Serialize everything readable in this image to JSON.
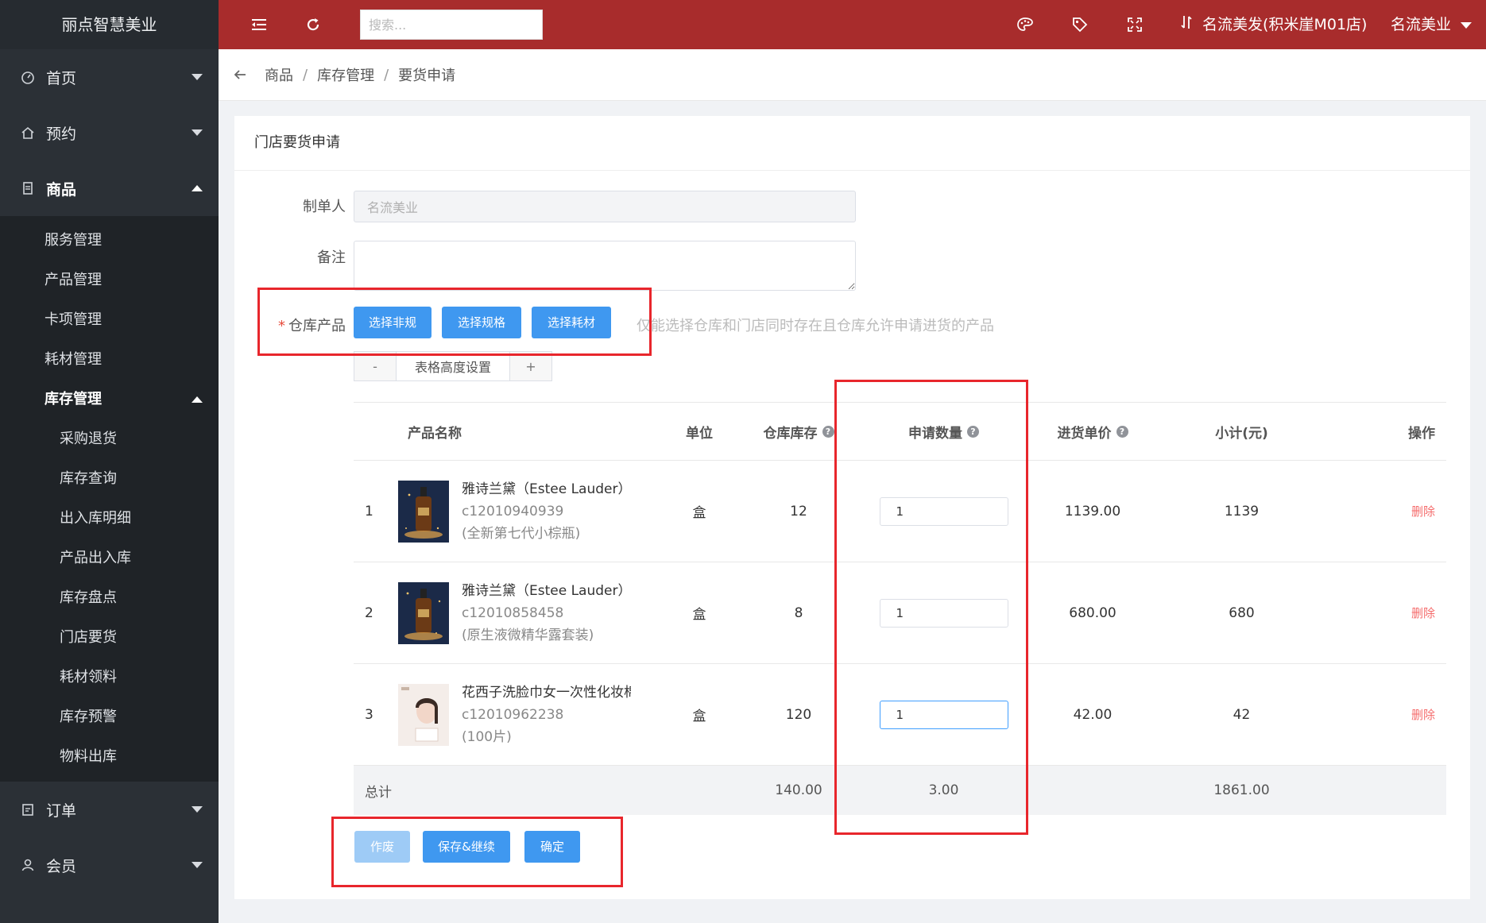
{
  "sidebar": {
    "brand": "丽点智慧美业",
    "menu": [
      {
        "label": "首页"
      },
      {
        "label": "预约"
      },
      {
        "label": "商品"
      }
    ],
    "goods_sub": [
      "服务管理",
      "产品管理",
      "卡项管理",
      "耗材管理"
    ],
    "stock_label": "库存管理",
    "stock_sub": [
      "采购退货",
      "库存查询",
      "出入库明细",
      "产品出入库",
      "库存盘点",
      "门店要货",
      "耗材领料",
      "库存预警",
      "物料出库"
    ],
    "bottom_menu": [
      {
        "label": "订单"
      },
      {
        "label": "会员"
      }
    ]
  },
  "topbar": {
    "search_placeholder": "搜索...",
    "store": "名流美发(积米崖M01店)",
    "user": "名流美业"
  },
  "breadcrumb": [
    "商品",
    "库存管理",
    "要货申请"
  ],
  "form": {
    "card_title": "门店要货申请",
    "maker_label": "制单人",
    "maker_value": "名流美业",
    "remark_label": "备注",
    "warehouse_label": "仓库产品",
    "btn_non_spec": "选择非规格",
    "btn_spec": "选择规格",
    "btn_material": "选择耗材",
    "hint": "仅能选择仓库和门店同时存在且仓库允许申请进货的产品",
    "stepper_minus": "-",
    "stepper_label": "表格高度设置",
    "stepper_plus": "+"
  },
  "table": {
    "headers": {
      "name": "产品名称",
      "unit": "单位",
      "stock": "仓库库存",
      "qty": "申请数量",
      "price": "进货单价",
      "subtotal": "小计(元)",
      "op": "操作"
    },
    "rows": [
      {
        "idx": "1",
        "name": "雅诗兰黛（Estee Lauder）特润修护肌活精华露",
        "code": "c12010940939",
        "spec": "(全新第七代小棕瓶)",
        "unit": "盒",
        "stock": "12",
        "qty": "1",
        "price": "1139.00",
        "subtotal": "1139",
        "op": "删除"
      },
      {
        "idx": "2",
        "name": "雅诗兰黛（Estee Lauder）特润修护肌活精华露",
        "code": "c12010858458",
        "spec": "(原生液微精华露套装)",
        "unit": "盒",
        "stock": "8",
        "qty": "1",
        "price": "680.00",
        "subtotal": "680",
        "op": "删除"
      },
      {
        "idx": "3",
        "name": "花西子洗脸巾女一次性化妆棉",
        "code": "c12010962238",
        "spec": "(100片)",
        "unit": "盒",
        "stock": "120",
        "qty": "1",
        "price": "42.00",
        "subtotal": "42",
        "op": "删除"
      }
    ],
    "footer": {
      "label": "总计",
      "stock_total": "140.00",
      "qty_total": "3.00",
      "subtotal_total": "1861.00"
    }
  },
  "actions": {
    "void": "作废",
    "save_continue": "保存&继续",
    "confirm": "确定"
  },
  "colors": {
    "topbar": "#a82c2c",
    "sidebar": "#2b3036",
    "primary": "#3f98f0",
    "danger": "#f56c6c",
    "highlight_box": "#e8262c"
  }
}
